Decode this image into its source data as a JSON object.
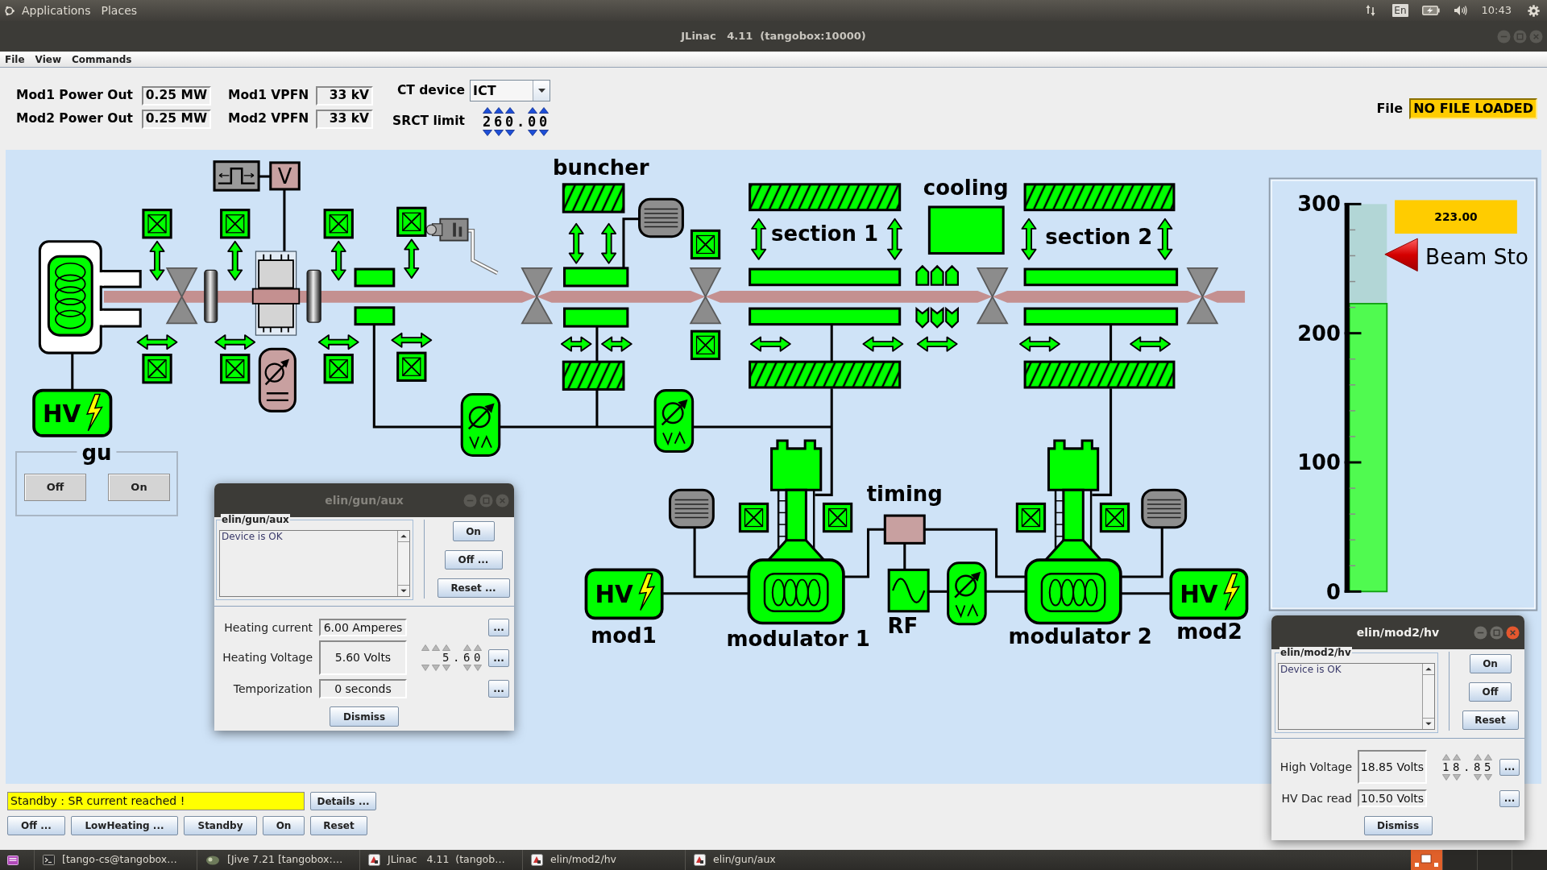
{
  "top_panel": {
    "menus": [
      "Applications",
      "Places"
    ],
    "keyboard_layout": "En",
    "clock": "10:43"
  },
  "window": {
    "title": "JLinac   4.11  (tangobox:10000)",
    "active": false
  },
  "menu_bar": [
    "File",
    "View",
    "Commands"
  ],
  "header": {
    "readings": [
      {
        "label": "Mod1 Power Out",
        "value": "0.25 MW"
      },
      {
        "label": "Mod1 VPFN",
        "value": "33 kV"
      },
      {
        "label": "Mod2 Power Out",
        "value": "0.25 MW"
      },
      {
        "label": "Mod2 VPFN",
        "value": "33 kV"
      }
    ],
    "ct_device": {
      "label": "CT device",
      "value": "ICT"
    },
    "srct_limit": {
      "label": "SRCT limit",
      "value": "260.00"
    },
    "file": {
      "label": "File",
      "value": "NO FILE LOADED"
    }
  },
  "synoptic": {
    "labels": [
      "buncher",
      "section 1",
      "cooling",
      "section 2",
      "timing",
      "RF",
      "mod1",
      "modulator 1",
      "modulator 2",
      "mod2"
    ],
    "voltage_tag": "V",
    "hv_supplies": [
      "HV",
      "HV",
      "HV"
    ],
    "gun_panel": {
      "title": "gu",
      "buttons": [
        "Off",
        "On"
      ]
    },
    "gauge": {
      "ticks": [
        "300",
        "200",
        "100",
        "0"
      ],
      "level": 0.743,
      "reading": "223.00",
      "marker_label": "Beam Sto"
    }
  },
  "dialogs": [
    {
      "title": "elin/gun/aux",
      "active": false,
      "device": "elin/gun/aux",
      "status": "Device is OK",
      "commands": [
        "On",
        "Off ...",
        "Reset ..."
      ],
      "attributes": [
        {
          "label": "Heating current",
          "value": "6.00 Amperes",
          "button": "..."
        },
        {
          "label": "Heating Voltage",
          "value": "5.60 Volts",
          "setpoint": "5.60",
          "button": "..."
        },
        {
          "label": "Temporization",
          "value": "0 seconds",
          "button": "..."
        }
      ],
      "dismiss": "Dismiss"
    },
    {
      "title": "elin/mod2/hv",
      "active": true,
      "device": "elin/mod2/hv",
      "status": "Device is OK",
      "commands": [
        "On",
        "Off",
        "Reset"
      ],
      "attributes": [
        {
          "label": "High Voltage",
          "value": "18.85 Volts",
          "setpoint": "18.85",
          "button": "..."
        },
        {
          "label": "HV Dac read",
          "value": "10.50 Volts",
          "button": "..."
        }
      ],
      "dismiss": "Dismiss"
    }
  ],
  "status_bar": {
    "message": "Standby : SR current reached !",
    "details_button": "Details ...",
    "buttons": [
      "Off ...",
      "LowHeating ...",
      "Standby",
      "On",
      "Reset"
    ]
  },
  "taskbar": {
    "items": [
      "[tango-cs@tangobox…",
      "[Jive 7.21 [tangobox:…",
      "JLinac   4.11  (tangob…",
      "elin/mod2/hv",
      "elin/gun/aux"
    ]
  }
}
